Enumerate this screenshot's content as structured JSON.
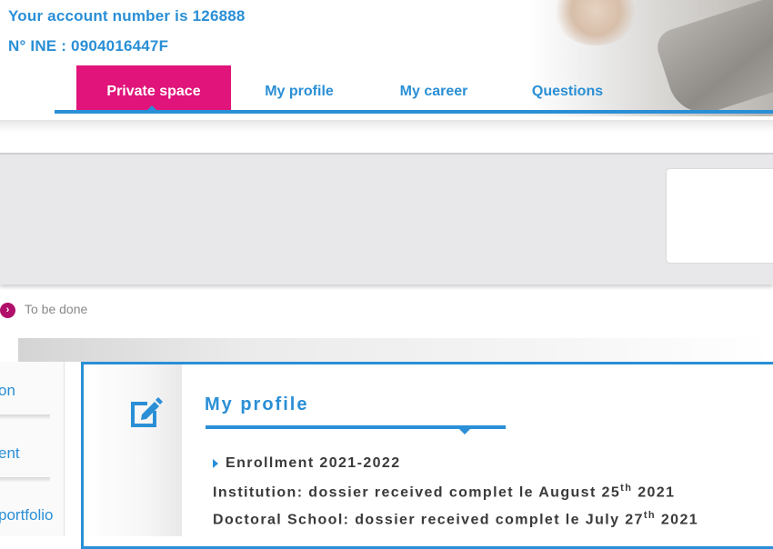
{
  "header": {
    "account_line": "Your account number is 126888",
    "ine_line": "N° INE : 0904016447F"
  },
  "nav": {
    "tabs": [
      {
        "label": "Private space",
        "active": true
      },
      {
        "label": "My profile",
        "active": false
      },
      {
        "label": "My career",
        "active": false
      },
      {
        "label": "Questions",
        "active": false
      }
    ]
  },
  "status": {
    "label": "To be done"
  },
  "sidebar": {
    "items": [
      {
        "label": "on"
      },
      {
        "label": "ent"
      },
      {
        "label": " portfolio"
      }
    ]
  },
  "panel": {
    "title": "My profile",
    "enrollment": "Enrollment 2021-2022",
    "institution": {
      "text": "Institution: dossier received complet le August 25",
      "sup": "th",
      "year": " 2021"
    },
    "doctoral": {
      "text": "Doctoral School: dossier received complet le July 27",
      "sup": "th",
      "year": " 2021"
    },
    "icon": "edit-icon"
  },
  "colors": {
    "accent": "#2a8fd6",
    "active_tab": "#e0147a",
    "status_dot": "#b0106a"
  }
}
